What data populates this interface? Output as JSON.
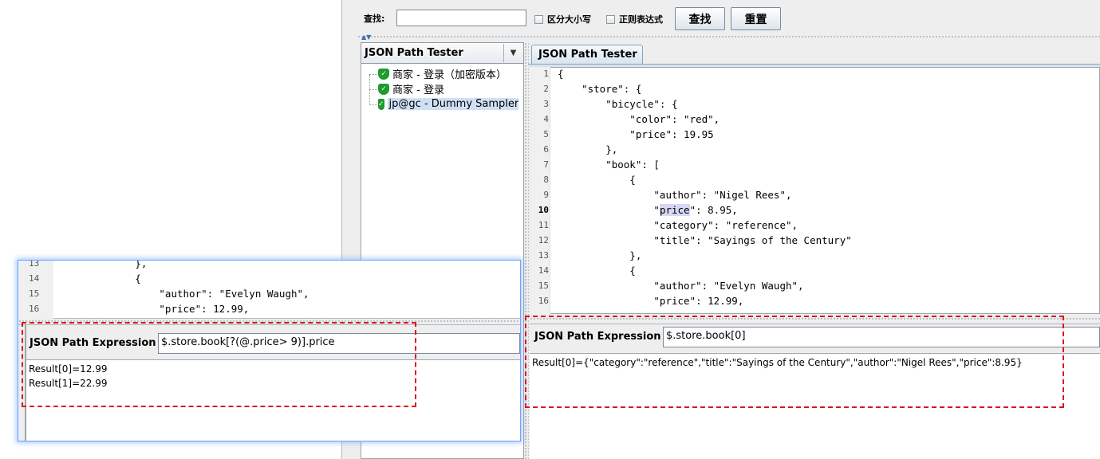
{
  "search": {
    "label": "查找:",
    "value": "",
    "case_sensitive_label": "区分大小写",
    "regex_label": "正则表达式",
    "find_button": "查找",
    "reset_button": "重置"
  },
  "tree": {
    "selector_label": "JSON Path Tester",
    "items": [
      {
        "label": "商家 - 登录（加密版本）",
        "selected": false
      },
      {
        "label": "商家 - 登录",
        "selected": false
      },
      {
        "label": "jp@gc - Dummy Sampler",
        "selected": true
      }
    ]
  },
  "right_panel": {
    "tab_label": "JSON Path Tester",
    "code_lines": [
      {
        "n": "1",
        "pre": "{",
        "hl": "",
        "post": ""
      },
      {
        "n": "2",
        "pre": "    \"store\": {",
        "hl": "",
        "post": ""
      },
      {
        "n": "3",
        "pre": "        \"bicycle\": {",
        "hl": "",
        "post": ""
      },
      {
        "n": "4",
        "pre": "            \"color\": \"red\",",
        "hl": "",
        "post": ""
      },
      {
        "n": "5",
        "pre": "            \"price\": 19.95",
        "hl": "",
        "post": ""
      },
      {
        "n": "6",
        "pre": "        },",
        "hl": "",
        "post": ""
      },
      {
        "n": "7",
        "pre": "        \"book\": [",
        "hl": "",
        "post": ""
      },
      {
        "n": "8",
        "pre": "            {",
        "hl": "",
        "post": ""
      },
      {
        "n": "9",
        "pre": "                \"author\": \"Nigel Rees\",",
        "hl": "",
        "post": ""
      },
      {
        "n": "10",
        "pre": "                \"",
        "hl": "price",
        "post": "\": 8.95,"
      },
      {
        "n": "11",
        "pre": "                \"category\": \"reference\",",
        "hl": "",
        "post": ""
      },
      {
        "n": "12",
        "pre": "                \"title\": \"Sayings of the Century\"",
        "hl": "",
        "post": ""
      },
      {
        "n": "13",
        "pre": "            },",
        "hl": "",
        "post": ""
      },
      {
        "n": "14",
        "pre": "            {",
        "hl": "",
        "post": ""
      },
      {
        "n": "15",
        "pre": "                \"author\": \"Evelyn Waugh\",",
        "hl": "",
        "post": ""
      },
      {
        "n": "16",
        "pre": "                \"price\": 12.99,",
        "hl": "",
        "post": ""
      }
    ],
    "active_line": "10",
    "expression_label": "JSON Path Expression",
    "expression_value": "$.store.book[0]",
    "results": [
      "Result[0]={\"category\":\"reference\",\"title\":\"Sayings of the Century\",\"author\":\"Nigel Rees\",\"price\":8.95}"
    ]
  },
  "popup": {
    "code_lines": [
      {
        "n": "13",
        "text": "            },"
      },
      {
        "n": "14",
        "text": "            {"
      },
      {
        "n": "15",
        "text": "                \"author\": \"Evelyn Waugh\","
      },
      {
        "n": "16",
        "text": "                \"price\": 12.99,"
      }
    ],
    "expression_label": "JSON Path Expression",
    "expression_value": "$.store.book[?(@.price> 9)].price",
    "results": [
      "Result[0]=12.99",
      "Result[1]=22.99"
    ]
  },
  "colors": {
    "annotation_red": "#e01414",
    "success_green": "#1f9a2e",
    "selection": "#cfe0f5"
  }
}
